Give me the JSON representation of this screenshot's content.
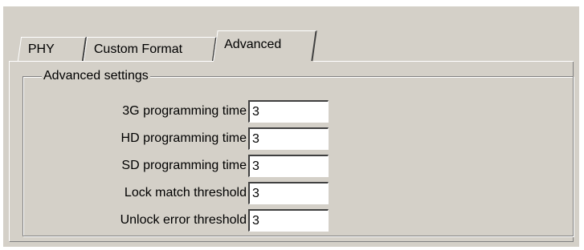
{
  "tabs": [
    {
      "label": "PHY"
    },
    {
      "label": "Custom Format"
    },
    {
      "label": "Advanced"
    }
  ],
  "active_tab": "Advanced",
  "group": {
    "title": "Advanced settings",
    "rows": [
      {
        "label": "3G programming time",
        "value": "3"
      },
      {
        "label": "HD programming time",
        "value": "3"
      },
      {
        "label": "SD programming time",
        "value": "3"
      },
      {
        "label": "Lock match threshold",
        "value": "3"
      },
      {
        "label": "Unlock error threshold",
        "value": "3"
      }
    ]
  }
}
